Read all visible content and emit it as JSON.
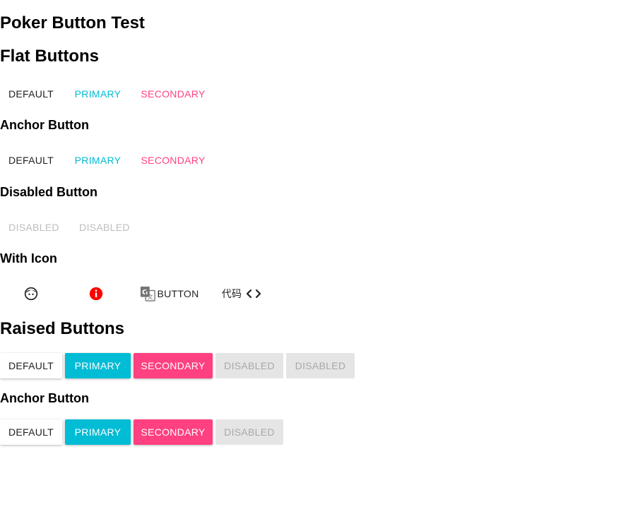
{
  "page": {
    "title": "Poker Button Test"
  },
  "flat": {
    "heading": "Flat Buttons",
    "buttons": [
      "DEFAULT",
      "PRIMARY",
      "SECONDARY"
    ]
  },
  "flat_anchor": {
    "heading": "Anchor Button",
    "buttons": [
      "DEFAULT",
      "PRIMARY",
      "SECONDARY"
    ]
  },
  "flat_disabled": {
    "heading": "Disabled Button",
    "buttons": [
      "DISABLED",
      "DISABLED"
    ]
  },
  "with_icon": {
    "heading": "With Icon",
    "icon_button_label": "BUTTON",
    "code_label": "代码",
    "icons": [
      "face-icon",
      "info-icon",
      "translate-icon",
      "code-icon"
    ]
  },
  "raised": {
    "heading": "Raised Buttons",
    "buttons": [
      "DEFAULT",
      "PRIMARY",
      "SECONDARY",
      "DISABLED",
      "DISABLED"
    ]
  },
  "raised_anchor": {
    "heading": "Anchor Button",
    "buttons": [
      "DEFAULT",
      "PRIMARY",
      "SECONDARY",
      "DISABLED"
    ]
  },
  "colors": {
    "primary": "#00bcd4",
    "secondary": "#ff4081",
    "default_text": "#212121",
    "disabled_text": "#bdbdbd",
    "raised_disabled_bg": "#e5e5e5",
    "info_red": "#ff0000"
  }
}
